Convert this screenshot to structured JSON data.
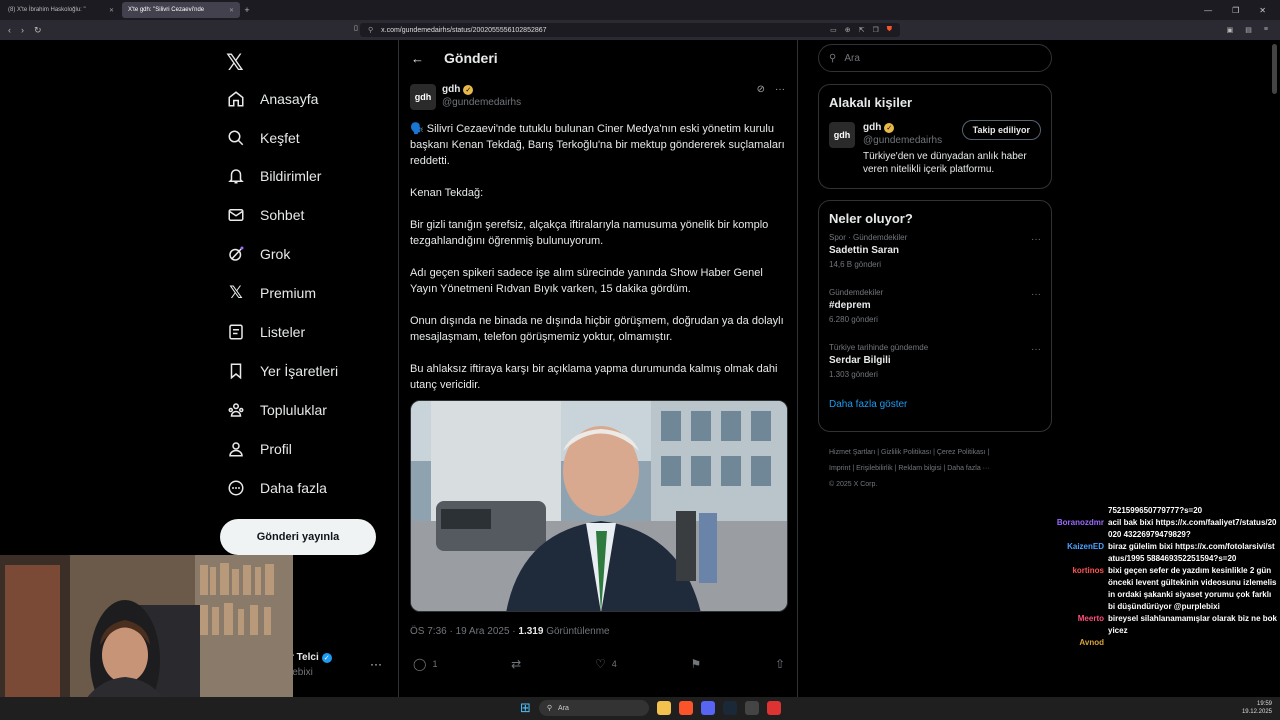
{
  "browser": {
    "tabs": [
      {
        "label": "(8) X'te İbrahim Haskoloğlu: \"",
        "active": false
      },
      {
        "label": "X'te gdh: \"Silivri Cezaevi'nde",
        "active": true
      }
    ],
    "url": "x.com/gundemedairhs/status/2002055556102852867"
  },
  "nav": {
    "items": [
      {
        "label": "Anasayfa",
        "icon": "home-icon"
      },
      {
        "label": "Keşfet",
        "icon": "search-icon"
      },
      {
        "label": "Bildirimler",
        "icon": "bell-icon"
      },
      {
        "label": "Sohbet",
        "icon": "mail-icon"
      },
      {
        "label": "Grok",
        "icon": "grok-icon"
      },
      {
        "label": "Premium",
        "icon": "x-icon"
      },
      {
        "label": "Listeler",
        "icon": "list-icon"
      },
      {
        "label": "Yer İşaretleri",
        "icon": "bookmark-icon"
      },
      {
        "label": "Topluluklar",
        "icon": "community-icon"
      },
      {
        "label": "Profil",
        "icon": "profile-icon"
      },
      {
        "label": "Daha fazla",
        "icon": "more-icon"
      }
    ],
    "post_button": "Gönderi yayınla",
    "account_name": "r Telci",
    "account_handle": "lebixi"
  },
  "post": {
    "header_title": "Gönderi",
    "author_name": "gdh",
    "author_handle": "@gundemedairhs",
    "avatar_text": "gdh",
    "paragraphs": [
      "🗣️ Silivri Cezaevi'nde tutuklu bulunan Ciner Medya'nın eski yönetim kurulu başkanı Kenan Tekdağ, Barış Terkoğlu'na bir mektup göndererek suçlamaları reddetti.",
      "Kenan Tekdağ:",
      "Bir gizli tanığın şerefsiz, alçakça iftiralarıyla namusuma yönelik bir komplo tezgahlandığını öğrenmiş bulunuyorum.",
      "Adı geçen spikeri sadece işe alım sürecinde yanında Show Haber Genel Yayın Yönetmeni Rıdvan Bıyık varken, 15 dakika gördüm.",
      "Onun dışında ne binada ne dışında hiçbir görüşmem, doğrudan ya da dolaylı mesajlaşmam, telefon görüşmemiz yoktur, olmamıştır.",
      "Bu ahlaksız iftiraya karşı bir açıklama yapma durumunda kalmış olmak dahi utanç vericidir."
    ],
    "time": "ÖS 7:36 · 19 Ara 2025 · ",
    "views": "1.319",
    "views_label": "Görüntülenme",
    "replies": "1",
    "likes": "4"
  },
  "right": {
    "search_placeholder": "Ara",
    "related_title": "Alakalı kişiler",
    "related": {
      "name": "gdh",
      "handle": "@gundemedairhs",
      "bio": "Türkiye'den ve dünyadan anlık haber veren nitelikli içerik platformu.",
      "follow_label": "Takip ediliyor"
    },
    "trends_title": "Neler oluyor?",
    "trends": [
      {
        "category": "Spor · Gündemdekiler",
        "title": "Sadettin Saran",
        "count": "14,6 B gönderi"
      },
      {
        "category": "Gündemdekiler",
        "title": "#deprem",
        "count": "6.280 gönderi"
      },
      {
        "category": "Türkiye tarihinde gündemde",
        "title": "Serdar Bilgili",
        "count": "1.303 gönderi"
      }
    ],
    "show_more": "Daha fazla göster",
    "footer_line1": "Hizmet Şartları  |  Gizlilik Politikası  |  Çerez Politikası  |",
    "footer_line2": "Imprint  |  Erişilebilirlik  |  Reklam bilgisi  |  Daha fazla ···",
    "footer_line3": "© 2025 X Corp."
  },
  "chat": [
    {
      "user": "",
      "color": "#ffffff",
      "text": "7521599650779777?s=20"
    },
    {
      "user": "Boranozdmr",
      "color": "#9b6bff",
      "text": "acil bak bixi https://x.com/faaliyet7/status/20020 43226979479829?"
    },
    {
      "user": "KaizenED",
      "color": "#4aa3ff",
      "text": "biraz gülelim bixi https://x.com/fotolarsivi/status/1995 588469352251594?s=20"
    },
    {
      "user": "kortinos",
      "color": "#ff5555",
      "text": "bixi geçen sefer de yazdım kesinlikle 2 gün önceki levent gültekinin videosunu izlemelisin ordaki şakanki siyaset yorumu çok farklı bi düşündürüyor @purplebixi"
    },
    {
      "user": "Meerto",
      "color": "#ff4f7a",
      "text": "bireysel silahlanamamışlar olarak biz ne bok yicez"
    },
    {
      "user": "Avnod",
      "color": "#d9a43a",
      "text": ""
    }
  ],
  "taskbar": {
    "search": "Ara",
    "time": "19:59",
    "date": "19.12.2025"
  }
}
